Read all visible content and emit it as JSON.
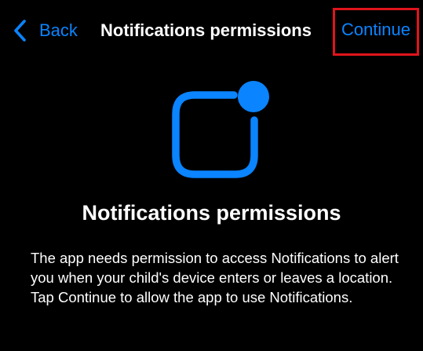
{
  "nav": {
    "back_label": "Back",
    "title": "Notifications permissions",
    "continue_label": "Continue"
  },
  "content": {
    "heading": "Notifications permissions",
    "description": "The app needs permission to access Notifications to alert you when your child's device enters or leaves a location. Tap Continue to allow the app to use Notifications."
  },
  "icons": {
    "back": "chevron-left-icon",
    "hero": "notification-badge-icon"
  },
  "colors": {
    "background": "#000000",
    "accent": "#0a84ff",
    "text": "#ffffff",
    "highlight_border": "#e0141c"
  }
}
